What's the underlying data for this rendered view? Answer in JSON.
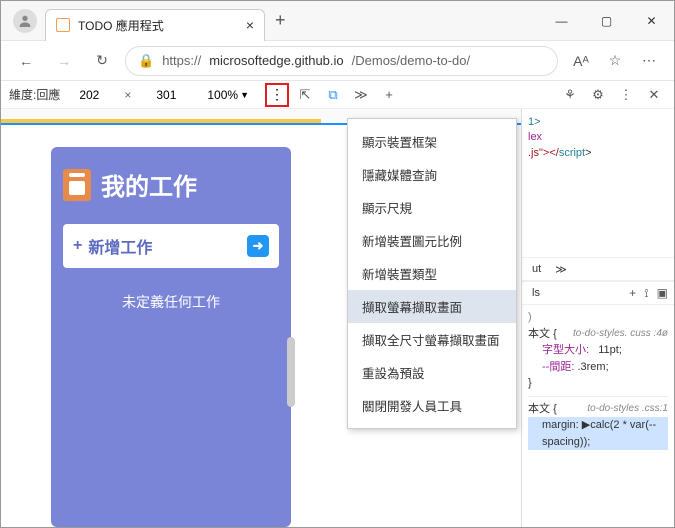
{
  "titlebar": {
    "tab_title": "TODO 應用程式",
    "close_glyph": "×",
    "newtab_glyph": "+",
    "min_glyph": "—",
    "max_glyph": "▢",
    "x_glyph": "✕"
  },
  "addr": {
    "back": "←",
    "fwd": "→",
    "reload": "↻",
    "lock": "🔒",
    "scheme": "https://",
    "host": "microsoftedge.github.io",
    "path": "/Demos/demo-to-do/",
    "aa": "Aᴬ",
    "star": "☆",
    "more": "⋯"
  },
  "devicebar": {
    "label": "維度:回應",
    "w": "202",
    "x": "×",
    "h": "301",
    "zoom": "100%",
    "zoom_caret": "▼",
    "more": "⋮",
    "cast": "⇱",
    "toggle": "⧉",
    "chev": "≫",
    "plus": "+",
    "ext": "⚘",
    "gear": "⚙",
    "more2": "⋮",
    "close": "✕"
  },
  "app": {
    "title": "我的工作",
    "add_plus": "+",
    "add_label": "新增工作",
    "go": "➜",
    "empty": "未定義任何工作"
  },
  "menu": {
    "items": [
      "顯示裝置框架",
      "隱藏媒體查詢",
      "顯示尺規",
      "新增裝置圖元比例",
      "新增裝置類型",
      "擷取螢幕擷取畫面",
      "擷取全尺寸螢幕擷取畫面",
      "重設為預設",
      "關閉開發人員工具"
    ],
    "selected_index": 5
  },
  "devright": {
    "tab_ut": "ut",
    "chev": "≫",
    "code": {
      "line1a": "1>",
      "line2a": "lex",
      "line3a": ".js\"></",
      "line3b": "script",
      "line3c": ">"
    },
    "styles_label": "ls",
    "icon_plus": "+",
    "icon_brush": "⟟",
    "icon_pop": "▣",
    "curly_open": "{",
    "curly_close": "}",
    "rule1_sel": "本文",
    "rule1_file": "to-do-styles. cuss :4ø",
    "rule1_p1n": "字型大小:",
    "rule1_p1v": "11pt;",
    "rule1_p2n": "--間距:",
    "rule1_p2v": ".3rem;",
    "rule2_sel": "本文",
    "rule2_file": "to-do-styles .css:1",
    "rule2_line": "margin: ▶calc(2 * var(--spacing));"
  }
}
